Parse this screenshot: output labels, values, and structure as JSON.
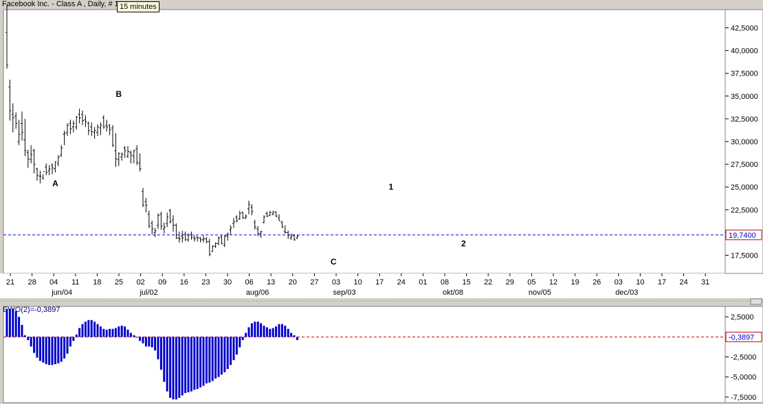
{
  "header": {
    "title": "Facebook Inc. - Class A , Daily, # 1",
    "tooltip": "15 minutes"
  },
  "chart_data": [
    {
      "type": "ohlc",
      "title": "Facebook Inc. - Class A , Daily, # 1",
      "price_axis_ticks": [
        "42,5000",
        "40,0000",
        "37,5000",
        "35,0000",
        "32,5000",
        "30,0000",
        "27,5000",
        "25,0000",
        "22,5000",
        "20,0000",
        "17,5000"
      ],
      "ylim": [
        15.5,
        44.5
      ],
      "reference_line": {
        "value": 19.74,
        "label": "19,7400",
        "color": "#0000cc"
      },
      "date_ticks": [
        "21",
        "28",
        "04",
        "11",
        "18",
        "25",
        "02",
        "09",
        "16",
        "23",
        "30",
        "06",
        "13",
        "20",
        "27",
        "03",
        "10",
        "17",
        "24",
        "01",
        "08",
        "15",
        "22",
        "29",
        "05",
        "12",
        "19",
        "26",
        "03",
        "10",
        "17",
        "24",
        "31"
      ],
      "month_labels": [
        {
          "text": "jun/04",
          "tick": 2
        },
        {
          "text": "jul/02",
          "tick": 6
        },
        {
          "text": "aug/06",
          "tick": 11
        },
        {
          "text": "sep/03",
          "tick": 15
        },
        {
          "text": "okt/08",
          "tick": 20
        },
        {
          "text": "nov/05",
          "tick": 24
        },
        {
          "text": "dec/03",
          "tick": 28
        }
      ],
      "wave_labels": [
        {
          "text": "A",
          "x": 16,
          "y": 25.1
        },
        {
          "text": "B",
          "x": 37,
          "y": 34.9
        },
        {
          "text": "C",
          "x": 108,
          "y": 16.5
        },
        {
          "text": "1",
          "x": 127,
          "y": 24.7
        },
        {
          "text": "2",
          "x": 151,
          "y": 18.5
        }
      ],
      "series": [
        {
          "name": "Facebook Inc. - Class A",
          "high": [
            45.0,
            36.8,
            34.2,
            33.2,
            32.4,
            33.3,
            32.5,
            29.1,
            29.6,
            29.2,
            27.1,
            26.8,
            26.4,
            27.6,
            27.4,
            27.6,
            27.8,
            28.5,
            29.6,
            31.2,
            32.0,
            32.4,
            32.3,
            32.8,
            33.6,
            33.4,
            32.9,
            32.2,
            32.1,
            31.6,
            31.9,
            32.1,
            32.9,
            32.4,
            31.9,
            31.8,
            30.9,
            28.8,
            28.8,
            29.5,
            29.5,
            29.0,
            29.1,
            29.6,
            28.7,
            24.9,
            23.8,
            22.4,
            21.3,
            20.5,
            22.1,
            22.3,
            21.1,
            22.2,
            22.6,
            21.9,
            21.0,
            20.1,
            20.2,
            20.1,
            19.9,
            20.1,
            19.7,
            19.6,
            19.5,
            19.7,
            19.5,
            19.3,
            18.6,
            18.9,
            19.6,
            19.7,
            19.7,
            20.0,
            20.8,
            21.6,
            21.9,
            22.4,
            22.3,
            22.0,
            23.5,
            23.1,
            21.4,
            20.7,
            20.2,
            21.9,
            22.3,
            22.4,
            22.4,
            22.3,
            22.0,
            21.3,
            20.8,
            20.2,
            19.9,
            19.8,
            19.7
          ],
          "low": [
            38.0,
            32.3,
            31.0,
            31.4,
            29.6,
            30.1,
            28.4,
            27.1,
            27.6,
            26.5,
            25.7,
            25.4,
            25.8,
            26.3,
            26.3,
            26.4,
            26.6,
            27.3,
            28.3,
            29.6,
            30.6,
            30.8,
            31.0,
            31.3,
            32.0,
            31.8,
            31.6,
            30.7,
            30.6,
            30.3,
            30.6,
            30.7,
            31.4,
            31.1,
            30.7,
            29.4,
            27.2,
            27.3,
            27.9,
            28.2,
            28.2,
            27.6,
            27.6,
            27.4,
            26.7,
            22.8,
            22.2,
            20.5,
            19.8,
            19.5,
            20.4,
            20.3,
            19.9,
            20.6,
            21.0,
            20.1,
            19.3,
            18.9,
            18.9,
            19.1,
            19.0,
            19.2,
            19.0,
            19.0,
            18.9,
            18.9,
            18.8,
            17.4,
            17.9,
            18.3,
            18.6,
            18.7,
            18.4,
            19.1,
            19.8,
            20.5,
            21.1,
            21.4,
            21.5,
            21.5,
            22.0,
            21.9,
            20.3,
            19.6,
            19.4,
            21.0,
            21.7,
            21.8,
            21.9,
            21.7,
            21.3,
            20.5,
            19.9,
            19.3,
            19.2,
            19.1,
            19.3
          ],
          "open": [
            42.0,
            36.0,
            33.0,
            32.8,
            30.0,
            32.0,
            30.2,
            28.8,
            28.0,
            29.0,
            27.0,
            26.2,
            26.0,
            27.2,
            26.8,
            27.4,
            27.0,
            27.6,
            28.5,
            30.8,
            31.0,
            32.0,
            31.6,
            31.6,
            33.0,
            33.0,
            32.4,
            32.0,
            31.6,
            31.0,
            31.0,
            31.5,
            32.6,
            31.8,
            31.8,
            31.5,
            29.0,
            28.0,
            28.3,
            29.3,
            28.4,
            28.8,
            28.4,
            29.2,
            27.6,
            24.5,
            23.4,
            22.0,
            21.0,
            20.0,
            20.8,
            22.0,
            20.4,
            21.0,
            22.4,
            21.4,
            20.8,
            19.4,
            19.6,
            19.8,
            19.2,
            19.8,
            19.4,
            19.5,
            19.4,
            19.2,
            19.3,
            19.0,
            17.9,
            18.5,
            18.8,
            19.5,
            18.6,
            19.6,
            20.3,
            21.0,
            21.7,
            21.5,
            22.2,
            21.6,
            22.6,
            22.8,
            21.1,
            20.4,
            19.9,
            21.1,
            22.1,
            21.9,
            22.0,
            22.3,
            21.6,
            21.1,
            20.1,
            20.0,
            19.4,
            19.7,
            19.4
          ],
          "close": [
            38.4,
            33.4,
            32.6,
            32.0,
            30.8,
            31.0,
            29.0,
            28.1,
            28.6,
            27.5,
            26.3,
            26.2,
            26.7,
            26.6,
            27.0,
            27.1,
            27.8,
            28.3,
            29.3,
            30.9,
            31.8,
            31.4,
            32.0,
            32.7,
            32.6,
            32.3,
            32.2,
            31.2,
            31.1,
            31.2,
            31.6,
            31.8,
            31.6,
            31.6,
            31.3,
            29.6,
            28.1,
            28.7,
            28.6,
            29.0,
            28.9,
            28.5,
            29.0,
            27.7,
            27.0,
            23.0,
            23.0,
            20.7,
            20.4,
            20.2,
            21.9,
            20.7,
            20.6,
            21.7,
            21.2,
            20.8,
            19.4,
            19.3,
            19.4,
            19.2,
            19.7,
            19.5,
            19.3,
            19.4,
            19.2,
            19.3,
            19.0,
            17.6,
            18.5,
            18.8,
            19.4,
            18.8,
            19.6,
            19.8,
            20.5,
            21.2,
            21.3,
            22.1,
            21.6,
            21.8,
            23.1,
            22.3,
            20.6,
            19.9,
            20.1,
            21.7,
            21.8,
            22.2,
            22.2,
            21.8,
            21.3,
            20.6,
            20.0,
            19.7,
            19.6,
            19.2,
            19.6
          ]
        }
      ]
    },
    {
      "type": "bar",
      "title": "EWO(2)=-0,3897",
      "name": "EWO(2)",
      "last_value_label": "-0,3897",
      "axis_ticks": [
        "2,5000",
        "0",
        "-2,5000",
        "-5,0000",
        "-7,5000"
      ],
      "ylim": [
        -8.2,
        3.8
      ],
      "values": [
        3.5,
        3.5,
        3.5,
        3.2,
        2.5,
        1.5,
        0.2,
        -0.4,
        -1.2,
        -2.0,
        -2.6,
        -3.0,
        -3.2,
        -3.4,
        -3.5,
        -3.5,
        -3.4,
        -3.3,
        -3.1,
        -2.7,
        -2.1,
        -1.2,
        -0.5,
        0.3,
        1.1,
        1.6,
        1.9,
        2.1,
        2.1,
        1.9,
        1.6,
        1.3,
        1.0,
        0.9,
        1.0,
        1.0,
        1.1,
        1.3,
        1.4,
        1.3,
        0.9,
        0.5,
        0.2,
        -0.1,
        -0.5,
        -0.8,
        -1.2,
        -1.2,
        -1.3,
        -1.7,
        -2.8,
        -4.1,
        -5.6,
        -6.8,
        -7.6,
        -7.8,
        -7.8,
        -7.6,
        -7.3,
        -7.0,
        -6.9,
        -6.8,
        -6.6,
        -6.5,
        -6.3,
        -6.1,
        -5.8,
        -5.7,
        -5.5,
        -5.2,
        -5.0,
        -4.7,
        -4.4,
        -4.0,
        -3.5,
        -2.9,
        -2.2,
        -1.3,
        -0.4,
        0.5,
        1.2,
        1.7,
        1.9,
        1.9,
        1.7,
        1.4,
        1.2,
        1.0,
        1.1,
        1.3,
        1.6,
        1.6,
        1.4,
        1.0,
        0.5,
        0.2,
        -0.4
      ]
    }
  ]
}
